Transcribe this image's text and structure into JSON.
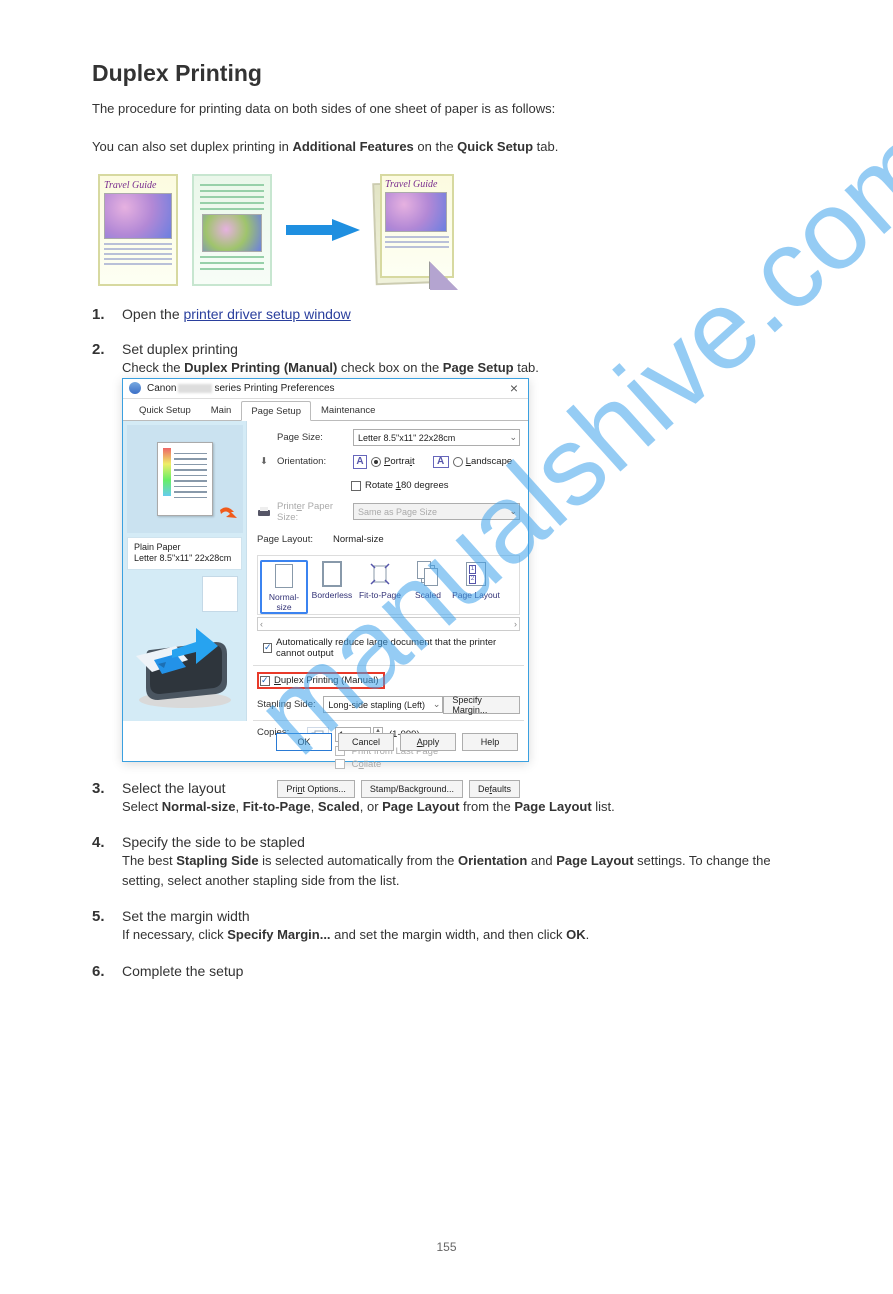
{
  "watermark": "manualshive.com",
  "heading": "Duplex Printing",
  "intro": "The procedure for printing data on both sides of one sheet of paper is as follows:",
  "quick_line_prefix": "You can also set duplex printing in ",
  "quick_line_bold": "Additional Features",
  "quick_line_mid": " on the ",
  "quick_line_bold2": "Quick Setup",
  "quick_line_suffix": " tab.",
  "illus": {
    "card1_title": "Travel Guide",
    "card3_title": "Travel Guide"
  },
  "steps": {
    "s1_num": "1.",
    "s1_title_prefix": "Open the ",
    "s1_title_link": "printer driver setup window",
    "s2_num": "2.",
    "s2_title": "Set duplex printing",
    "s2_body_a": "Check the ",
    "s2_body_b": "Duplex Printing (Manual)",
    "s2_body_c": " check box on the ",
    "s2_body_d": "Page Setup",
    "s2_body_e": " tab.",
    "s3_num": "3.",
    "s3_title": "Select the layout",
    "s3_body_a": "Select ",
    "s3_body_b1": "Normal-size",
    "s3_body_b2": "Fit-to-Page",
    "s3_body_b3": "Scaled",
    "s3_body_b4": "Page Layout",
    "s3_body_mid1": ", ",
    "s3_body_mid2": ", or ",
    "s3_body_c": " from the ",
    "s3_body_d": "Page Layout",
    "s3_body_e": " list.",
    "s4_num": "4.",
    "s4_title": "Specify the side to be stapled",
    "s4_body_a": "The best ",
    "s4_body_b": "Stapling Side",
    "s4_body_c": " is selected automatically from the ",
    "s4_body_d": "Orientation",
    "s4_body_e": " and ",
    "s4_body_f": "Page Layout",
    "s4_body_g": " settings. To change the setting, select another stapling side from the list.",
    "s5_num": "5.",
    "s5_title": "Set the margin width",
    "s5_body_a": "If necessary, click ",
    "s5_body_b": "Specify Margin...",
    "s5_body_c": " and set the margin width, and then click ",
    "s5_body_d": "OK",
    "s5_body_e": ".",
    "s6_num": "6.",
    "s6_title": "Complete the setup"
  },
  "dialog": {
    "title_prefix": "Canon",
    "title_suffix": "series Printing Preferences",
    "tabs": {
      "t1": "Quick Setup",
      "t2": "Main",
      "t3": "Page Setup",
      "t4": "Maintenance"
    },
    "left": {
      "label_line1": "Plain Paper",
      "label_line2": "Letter 8.5\"x11\" 22x28cm"
    },
    "right": {
      "page_size_label": "Page Size:",
      "page_size_value": "Letter 8.5\"x11\" 22x28cm",
      "orientation_label": "Orientation:",
      "portrait": "Portrait",
      "landscape": "Landscape",
      "rotate": "Rotate 180 degrees",
      "printer_paper_label": "Printer Paper Size:",
      "printer_paper_value": "Same as Page Size",
      "page_layout_label": "Page Layout:",
      "page_layout_value": "Normal-size",
      "layout_opts": {
        "o1": "Normal-size",
        "o2": "Borderless",
        "o3": "Fit-to-Page",
        "o4": "Scaled",
        "o5": "Page Layout"
      },
      "auto_reduce": "Automatically reduce large document that the printer cannot output",
      "duplex": "Duplex Printing (Manual)",
      "stapling_label": "Stapling Side:",
      "stapling_value": "Long-side stapling (Left)",
      "specify_margin": "Specify Margin...",
      "copies_label": "Copies:",
      "copies_value": "1",
      "copies_range": "(1-999)",
      "print_from_last": "Print from Last Page",
      "collate": "Collate",
      "print_options": "Print Options...",
      "stamp_bg": "Stamp/Background...",
      "defaults": "Defaults"
    },
    "buttons": {
      "ok": "OK",
      "cancel": "Cancel",
      "apply": "Apply",
      "help": "Help"
    }
  },
  "page_number": "155"
}
